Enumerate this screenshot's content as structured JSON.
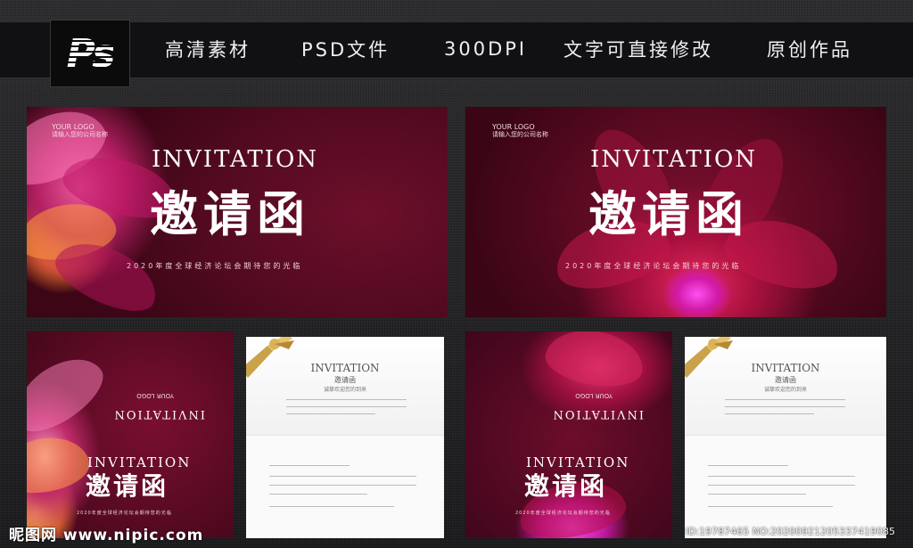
{
  "header": {
    "ps_logo": "Ps",
    "features": [
      "高清素材",
      "PSD文件",
      "300DPI",
      "文字可直接修改",
      "原创作品"
    ]
  },
  "invitation": {
    "logo_line1": "YOUR LOGO",
    "logo_line2": "请输入您的公司名称",
    "title_en": "INVITATION",
    "title_cn": "邀请函",
    "subtitle": "2020年度全球经济论坛会期待您的光临"
  },
  "card": {
    "title_en": "INVITATION",
    "title_cn": "邀请函",
    "greeting": "诚挚欢迎您的到来"
  },
  "watermark": {
    "left": "昵图网 www.nipic.com",
    "right": "ID:19787465 NO:20200921205337419085"
  },
  "colors": {
    "header_bg": "#111113",
    "page_bg": "#1e1e20",
    "card_dark": "#520a20",
    "accent_pink": "#e6275d",
    "ribbon_gold": "#c9a24a"
  }
}
